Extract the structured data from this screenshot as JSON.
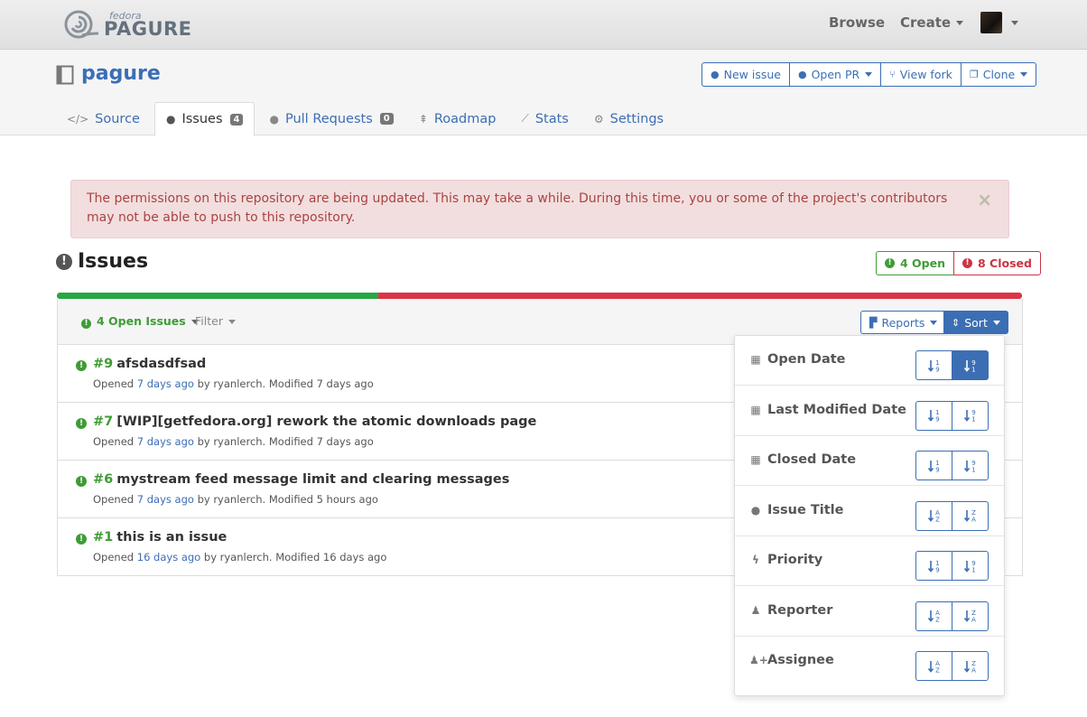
{
  "navbar": {
    "logo_small": "fedora",
    "logo_big": "PAGURE",
    "browse": "Browse",
    "create": "Create"
  },
  "repo": {
    "name": "pagure",
    "actions": {
      "new_issue": "New issue",
      "open_pr": "Open PR",
      "view_fork": "View fork",
      "clone": "Clone"
    },
    "tabs": [
      {
        "label": "Source"
      },
      {
        "label": "Issues",
        "badge": "4"
      },
      {
        "label": "Pull Requests",
        "badge": "0"
      },
      {
        "label": "Roadmap"
      },
      {
        "label": "Stats"
      },
      {
        "label": "Settings"
      }
    ]
  },
  "alert": {
    "message": "The permissions on this repository are being updated. This may take a while. During this time, you or some of the project's contributors may not be able to push to this repository.",
    "close": "×"
  },
  "issues": {
    "title": "Issues",
    "open_count": "4 Open",
    "closed_count": "8 Closed",
    "open_fraction": 0.333,
    "filter_open": "4 Open Issues",
    "filter": "Filter",
    "reports": "Reports",
    "sort": "Sort",
    "list": [
      {
        "num": "#9",
        "title": "afsdasdfsad",
        "opened_prefix": "Opened",
        "opened": "7 days ago",
        "by": "by ryanlerch. Modified 7 days ago"
      },
      {
        "num": "#7",
        "title": "[WIP][getfedora.org] rework the atomic downloads page",
        "opened_prefix": "Opened",
        "opened": "7 days ago",
        "by": "by ryanlerch. Modified 7 days ago"
      },
      {
        "num": "#6",
        "title": "mystream feed message limit and clearing messages",
        "opened_prefix": "Opened",
        "opened": "7 days ago",
        "by": "by ryanlerch. Modified 5 hours ago"
      },
      {
        "num": "#1",
        "title": "this is an issue",
        "opened_prefix": "Opened",
        "opened": "16 days ago",
        "by": "by ryanlerch. Modified 16 days ago"
      }
    ]
  },
  "sort_menu": [
    {
      "label": "Open Date",
      "icon": "calendar-icon",
      "kind": "numeric",
      "active": "desc"
    },
    {
      "label": "Last Modified Date",
      "icon": "calendar-icon",
      "kind": "numeric",
      "active": ""
    },
    {
      "label": "Closed Date",
      "icon": "calendar-icon",
      "kind": "numeric",
      "active": ""
    },
    {
      "label": "Issue Title",
      "icon": "exclamation-circle-icon",
      "kind": "alpha",
      "active": ""
    },
    {
      "label": "Priority",
      "icon": "bolt-icon",
      "kind": "numeric",
      "active": ""
    },
    {
      "label": "Reporter",
      "icon": "user-icon",
      "kind": "alpha",
      "active": ""
    },
    {
      "label": "Assignee",
      "icon": "user-plus-icon",
      "kind": "alpha",
      "active": ""
    }
  ],
  "colors": {
    "brand_blue": "#3c6eb4",
    "open_green": "#3f9c35",
    "closed_red": "#cc3344"
  }
}
